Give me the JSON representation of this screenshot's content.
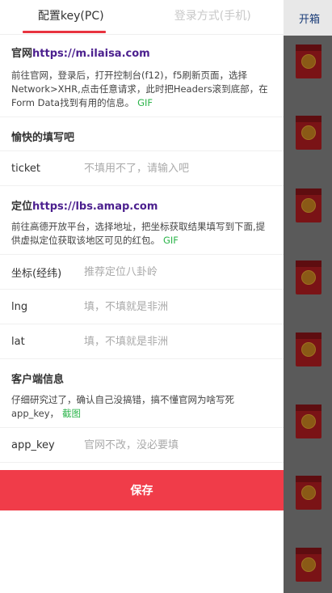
{
  "background": {
    "top_right_text": "开箱"
  },
  "tabs": [
    {
      "label": "配置key(PC)",
      "active": true
    },
    {
      "label": "登录方式(手机)",
      "active": false
    }
  ],
  "sections": {
    "official": {
      "title_prefix": "官网",
      "title_link": "https://m.ilaisa.com",
      "desc": "前往官网，登录后，打开控制台(f12)，f5刷新页面，选择Network>XHR,点击任意请求，此时把Headers滚到底部，在Form Data找到有用的信息。",
      "desc_link": "GIF"
    },
    "fill": {
      "title": "愉快的填写吧",
      "ticket_label": "ticket",
      "ticket_placeholder": "不填用不了，请输入吧"
    },
    "location": {
      "title_prefix": "定位",
      "title_link": "https://lbs.amap.com",
      "desc": "前往高德开放平台，选择地址，把坐标获取结果填写到下面,提供虚拟定位获取该地区可见的红包。",
      "desc_link": "GIF",
      "coord_label": "坐标(经纬)",
      "coord_placeholder": "推荐定位八卦岭",
      "lng_label": "lng",
      "lng_placeholder": "填，不填就是非洲",
      "lat_label": "lat",
      "lat_placeholder": "填，不填就是非洲"
    },
    "client": {
      "title": "客户端信息",
      "desc": "仔细研究过了，确认自己没搞错，搞不懂官网为啥写死app_key，",
      "desc_link": "截图",
      "appkey_label": "app_key",
      "appkey_placeholder": "官网不改，没必要填"
    }
  },
  "save_label": "保存",
  "colors": {
    "accent": "#f03c49",
    "link_purple": "#4b1f8e",
    "link_green": "#2bb44a"
  }
}
